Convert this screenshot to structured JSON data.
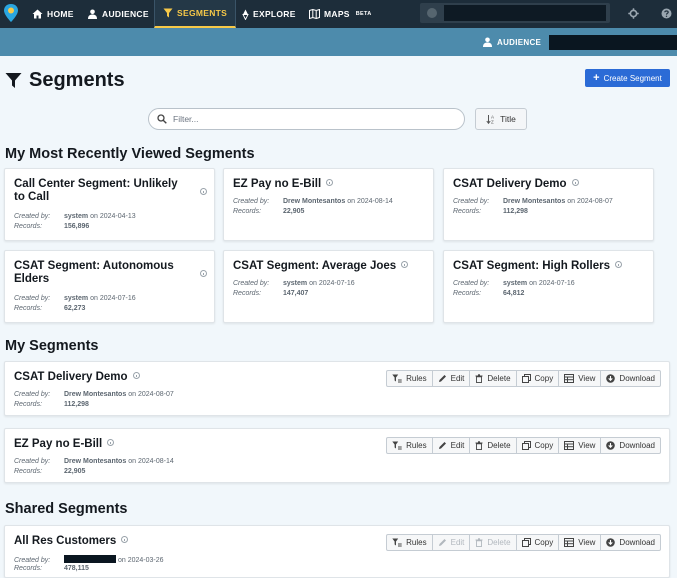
{
  "topnav": {
    "items": [
      {
        "label": "HOME",
        "icon": "home-icon"
      },
      {
        "label": "AUDIENCE",
        "icon": "audience-icon"
      },
      {
        "label": "SEGMENTS",
        "icon": "filter-icon",
        "active": true
      },
      {
        "label": "EXPLORE",
        "icon": "explore-icon"
      },
      {
        "label": "MAPS",
        "icon": "map-icon",
        "badge": "BETA"
      }
    ]
  },
  "subnav": {
    "audience_label": "AUDIENCE"
  },
  "page": {
    "title": "Segments",
    "create_label": "Create Segment"
  },
  "filter": {
    "placeholder": "Filter...",
    "sort_label": "Title"
  },
  "recent": {
    "title": "My Most Recently Viewed Segments",
    "cards": [
      {
        "title": "Call Center Segment: Unlikely to Call",
        "created_by_label": "Created by:",
        "creator": "system",
        "on": "on",
        "date": "2024-04-13",
        "records_label": "Records:",
        "records": "156,896"
      },
      {
        "title": "EZ Pay no E-Bill",
        "created_by_label": "Created by:",
        "creator": "Drew Montesantos",
        "on": "on",
        "date": "2024-08-14",
        "records_label": "Records:",
        "records": "22,905"
      },
      {
        "title": "CSAT Delivery Demo",
        "created_by_label": "Created by:",
        "creator": "Drew Montesantos",
        "on": "on",
        "date": "2024-08-07",
        "records_label": "Records:",
        "records": "112,298"
      },
      {
        "title": "CSAT Segment: Autonomous Elders",
        "created_by_label": "Created by:",
        "creator": "system",
        "on": "on",
        "date": "2024-07-16",
        "records_label": "Records:",
        "records": "62,273"
      },
      {
        "title": "CSAT Segment: Average Joes",
        "created_by_label": "Created by:",
        "creator": "system",
        "on": "on",
        "date": "2024-07-16",
        "records_label": "Records:",
        "records": "147,407"
      },
      {
        "title": "CSAT Segment: High Rollers",
        "created_by_label": "Created by:",
        "creator": "system",
        "on": "on",
        "date": "2024-07-16",
        "records_label": "Records:",
        "records": "64,812"
      }
    ]
  },
  "mine": {
    "title": "My Segments",
    "rows": [
      {
        "title": "CSAT Delivery Demo",
        "created_by_label": "Created by:",
        "creator": "Drew Montesantos",
        "on": "on",
        "date": "2024-08-07",
        "records_label": "Records:",
        "records": "112,298"
      },
      {
        "title": "EZ Pay no E-Bill",
        "created_by_label": "Created by:",
        "creator": "Drew Montesantos",
        "on": "on",
        "date": "2024-08-14",
        "records_label": "Records:",
        "records": "22,905"
      }
    ]
  },
  "shared": {
    "title": "Shared Segments",
    "rows": [
      {
        "title": "All Res Customers",
        "created_by_label": "Created by:",
        "on": "on",
        "date": "2024-03-26",
        "records_label": "Records:",
        "records": "478,115"
      }
    ]
  },
  "actions": {
    "rules": "Rules",
    "edit": "Edit",
    "delete": "Delete",
    "copy": "Copy",
    "view": "View",
    "download": "Download"
  },
  "colors": {
    "nav_bg": "#1d2d3a",
    "subnav_bg": "#4d8bac",
    "active": "#f7c948",
    "primary": "#2b6bd6",
    "page_bg": "#f1f7fb"
  }
}
